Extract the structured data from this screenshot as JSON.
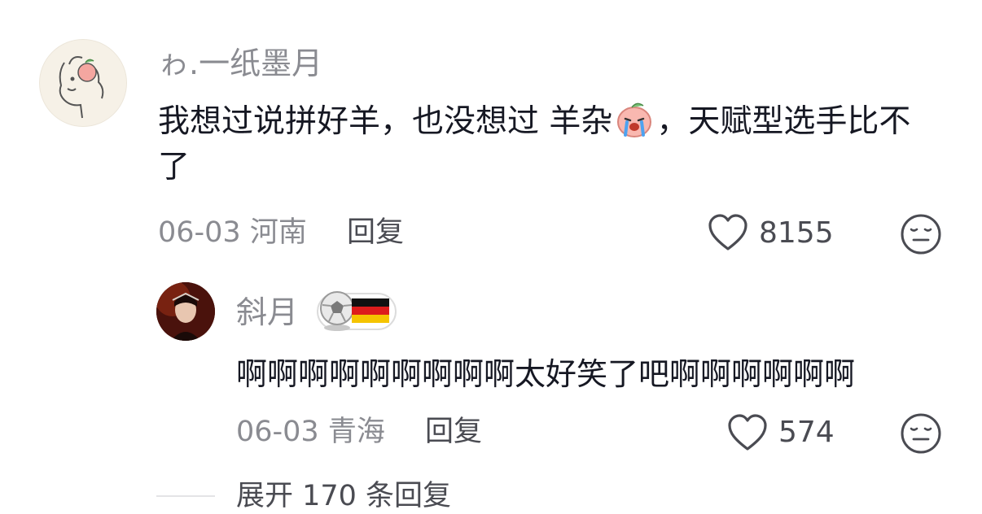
{
  "comment": {
    "username": "ゎ.一纸墨月",
    "text_part1": "我想过说拼好羊，也没想过 羊杂",
    "text_part2": "，天赋型选手比不了",
    "date": "06-03",
    "location": "河南",
    "reply_label": "回复",
    "like_count": "8155"
  },
  "reply": {
    "username": "斜月",
    "text": "啊啊啊啊啊啊啊啊啊太好笑了吧啊啊啊啊啊啊",
    "date": "06-03",
    "location": "青海",
    "reply_label": "回复",
    "like_count": "574"
  },
  "expand_label": "展开 170 条回复",
  "icons": {
    "like": "heart-outline-icon",
    "dislike": "neutral-face-icon",
    "emoji": "crying-peach-emoji",
    "badge_ball": "soccer-ball-icon",
    "badge_flag": "germany-flag-icon"
  }
}
